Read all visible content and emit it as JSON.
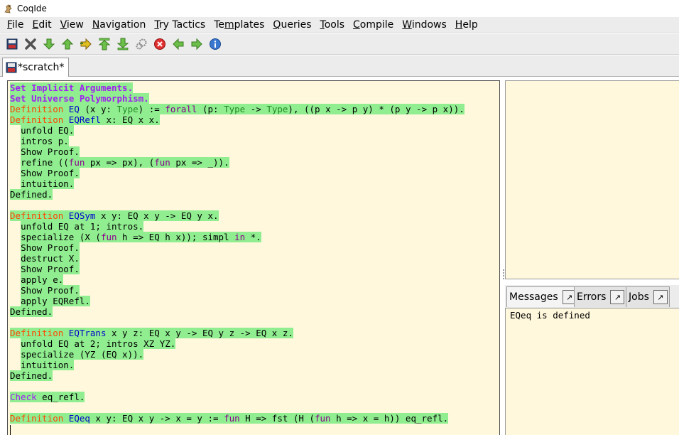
{
  "window": {
    "title": "CoqIde"
  },
  "menu": [
    {
      "pre": "",
      "mn": "F",
      "post": "ile"
    },
    {
      "pre": "",
      "mn": "E",
      "post": "dit"
    },
    {
      "pre": "",
      "mn": "V",
      "post": "iew"
    },
    {
      "pre": "",
      "mn": "N",
      "post": "avigation"
    },
    {
      "pre": "",
      "mn": "T",
      "post": "ry Tactics"
    },
    {
      "pre": "Te",
      "mn": "m",
      "post": "plates"
    },
    {
      "pre": "",
      "mn": "Q",
      "post": "ueries"
    },
    {
      "pre": "",
      "mn": "T",
      "post": "ools"
    },
    {
      "pre": "",
      "mn": "C",
      "post": "ompile"
    },
    {
      "pre": "",
      "mn": "W",
      "post": "indows"
    },
    {
      "pre": "",
      "mn": "H",
      "post": "elp"
    }
  ],
  "toolbar_icons": [
    "save-icon",
    "close-icon",
    "forward-one-icon",
    "backward-one-icon",
    "go-to-cursor-icon",
    "go-to-start-icon",
    "go-to-end-icon",
    "compute-icon",
    "interrupt-icon",
    "previous-error-icon",
    "next-error-icon",
    "about-icon"
  ],
  "tab": {
    "label": "*scratch*"
  },
  "editor": {
    "lines": [
      [
        [
          "Set Implicit Arguments.",
          "kw-vern ck"
        ]
      ],
      [
        [
          "Set Universe Polymorphism.",
          "kw-vern ck"
        ]
      ],
      [
        [
          "Definition",
          "kw-def ck"
        ],
        [
          " ",
          "ck"
        ],
        [
          "EQ",
          "kw-name ck"
        ],
        [
          " (x y: ",
          "ck"
        ],
        [
          "Type",
          "kw-type ck"
        ],
        [
          ") := ",
          "ck"
        ],
        [
          "forall",
          "kw-fun ck"
        ],
        [
          " (p: ",
          "ck"
        ],
        [
          "Type",
          "kw-type ck"
        ],
        [
          " -> ",
          "ck"
        ],
        [
          "Type",
          "kw-type ck"
        ],
        [
          "), ((p x -> p y) * (p y -> p x)).",
          "ck"
        ]
      ],
      [
        [
          "Definition",
          "kw-def ck"
        ],
        [
          " ",
          "ck"
        ],
        [
          "EQRefl",
          "kw-name ck"
        ],
        [
          " x: EQ x x.",
          "ck"
        ]
      ],
      [
        [
          "  ",
          ""
        ],
        [
          "unfold EQ.",
          "ck"
        ]
      ],
      [
        [
          "  ",
          ""
        ],
        [
          "intros p.",
          "ck"
        ]
      ],
      [
        [
          "  ",
          ""
        ],
        [
          "Show Proof.",
          "ck"
        ]
      ],
      [
        [
          "  ",
          ""
        ],
        [
          "refine ((",
          "ck"
        ],
        [
          "fun",
          "kw-fun ck"
        ],
        [
          " px => px), (",
          "ck"
        ],
        [
          "fun",
          "kw-fun ck"
        ],
        [
          " px => _)).",
          "ck"
        ]
      ],
      [
        [
          "  ",
          ""
        ],
        [
          "Show Proof.",
          "ck"
        ]
      ],
      [
        [
          "  ",
          ""
        ],
        [
          "intuition.",
          "ck"
        ]
      ],
      [
        [
          "Defined.",
          "ck"
        ]
      ],
      [],
      [
        [
          "Definition",
          "kw-def ck"
        ],
        [
          " ",
          "ck"
        ],
        [
          "EQSym",
          "kw-name ck"
        ],
        [
          " x y: EQ x y -> EQ y x.",
          "ck"
        ]
      ],
      [
        [
          "  ",
          ""
        ],
        [
          "unfold EQ at 1; intros.",
          "ck"
        ]
      ],
      [
        [
          "  ",
          ""
        ],
        [
          "specialize (X (",
          "ck"
        ],
        [
          "fun",
          "kw-fun ck"
        ],
        [
          " h => EQ h x)); simpl ",
          "ck"
        ],
        [
          "in",
          "kw-fun ck"
        ],
        [
          " *.",
          "ck"
        ]
      ],
      [
        [
          "  ",
          ""
        ],
        [
          "Show Proof.",
          "ck"
        ]
      ],
      [
        [
          "  ",
          ""
        ],
        [
          "destruct X.",
          "ck"
        ]
      ],
      [
        [
          "  ",
          ""
        ],
        [
          "Show Proof.",
          "ck"
        ]
      ],
      [
        [
          "  ",
          ""
        ],
        [
          "apply e.",
          "ck"
        ]
      ],
      [
        [
          "  ",
          ""
        ],
        [
          "Show Proof.",
          "ck"
        ]
      ],
      [
        [
          "  ",
          ""
        ],
        [
          "apply EQRefl.",
          "ck"
        ]
      ],
      [
        [
          "Defined.",
          "ck"
        ]
      ],
      [],
      [
        [
          "Definition",
          "kw-def ck"
        ],
        [
          " ",
          "ck"
        ],
        [
          "EQTrans",
          "kw-name ck"
        ],
        [
          " x y z: EQ x y -> EQ y z -> EQ x z.",
          "ck"
        ]
      ],
      [
        [
          "  ",
          ""
        ],
        [
          "unfold EQ at 2; intros XZ YZ.",
          "ck"
        ]
      ],
      [
        [
          "  ",
          ""
        ],
        [
          "specialize (YZ (EQ x)).",
          "ck"
        ]
      ],
      [
        [
          "  ",
          ""
        ],
        [
          "intuition.",
          "ck"
        ]
      ],
      [
        [
          "Defined.",
          "ck"
        ]
      ],
      [],
      [
        [
          "Check",
          "kw-check ck"
        ],
        [
          " eq_refl.",
          "ck"
        ]
      ],
      [],
      [
        [
          "Definition",
          "kw-def ck"
        ],
        [
          " ",
          "ck"
        ],
        [
          "EQeq",
          "kw-name ck"
        ],
        [
          " x y: EQ x y -> x = y := ",
          "ck"
        ],
        [
          "fun",
          "kw-fun ck"
        ],
        [
          " H => fst (H (",
          "ck"
        ],
        [
          "fun",
          "kw-fun ck"
        ],
        [
          " h => x = h)) eq_refl.",
          "ck"
        ]
      ]
    ]
  },
  "message_tabs": [
    {
      "label": "Messages",
      "active": true
    },
    {
      "label": "Errors",
      "active": false
    },
    {
      "label": "Jobs",
      "active": false
    }
  ],
  "messages": {
    "text": "EQeq is defined"
  },
  "colors": {
    "processed": "#90ee90",
    "editor_bg": "#fff8dc",
    "keyword_definition": "#ff4500",
    "keyword_vernacular": "#a020f0",
    "identifier": "#0000cd",
    "type": "#228b22"
  }
}
